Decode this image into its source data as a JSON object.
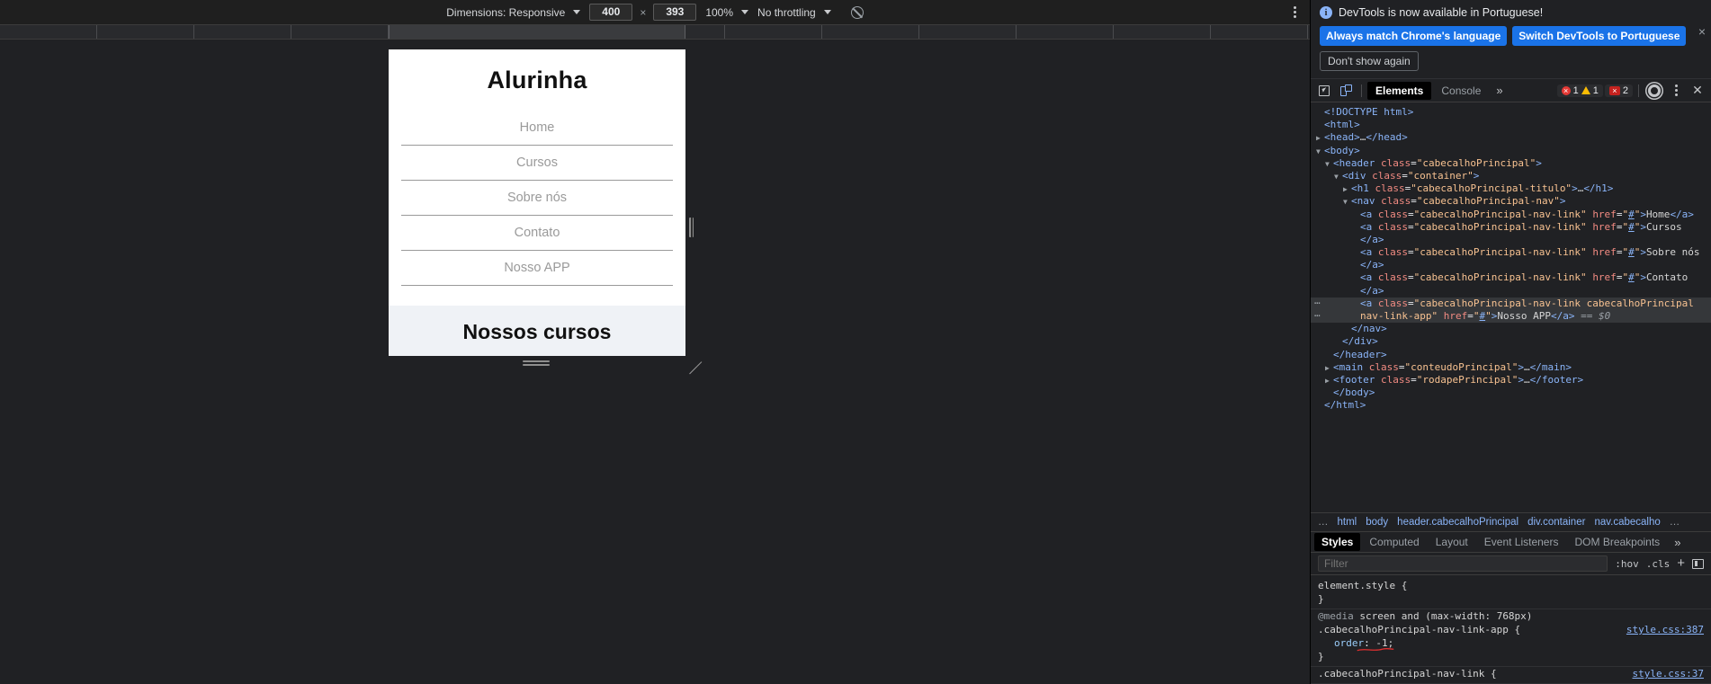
{
  "device_toolbar": {
    "dimensions_label": "Dimensions: Responsive",
    "width_value": "400",
    "times": "×",
    "height_value": "393",
    "zoom_label": "100%",
    "throttling_label": "No throttling",
    "no_throttle_icon": "no-network-throttle-icon",
    "kebab_icon": "more-options-icon"
  },
  "emulated_page": {
    "title": "Alurinha",
    "nav": [
      {
        "label": "Home"
      },
      {
        "label": "Cursos"
      },
      {
        "label": "Sobre nós"
      },
      {
        "label": "Contato"
      },
      {
        "label": "Nosso APP"
      }
    ],
    "section_title": "Nossos cursos"
  },
  "notification": {
    "info_icon": "info-icon",
    "message": "DevTools is now available in Portuguese!",
    "primary_button": "Always match Chrome's language",
    "secondary_button": "Switch DevTools to Portuguese",
    "dismiss_button": "Don't show again",
    "close_icon": "×"
  },
  "devtools_tabbar": {
    "inspect_icon": "inspect-element-icon",
    "device_icon": "toggle-device-toolbar-icon",
    "tabs": [
      {
        "label": "Elements",
        "active": true
      },
      {
        "label": "Console",
        "active": false
      }
    ],
    "more_tabs_icon": "»",
    "error_count": "1",
    "warning_count": "1",
    "issue_count": "2",
    "settings_icon": "gear-icon",
    "kebab_icon": "more-options-icon",
    "close_icon": "close-icon"
  },
  "dom_tree": {
    "lines": [
      {
        "indent": 0,
        "twisty": "",
        "html": "<span class=\"tag\">&lt;!DOCTYPE html&gt;</span>"
      },
      {
        "indent": 0,
        "twisty": "",
        "html": "<span class=\"tag\">&lt;html&gt;</span>"
      },
      {
        "indent": 0,
        "twisty": "▶",
        "html": "<span class=\"tag\">&lt;head&gt;</span><span class=\"txt\">…</span><span class=\"tag\">&lt;/head&gt;</span>"
      },
      {
        "indent": 0,
        "twisty": "▼",
        "html": "<span class=\"tag\">&lt;body&gt;</span>"
      },
      {
        "indent": 1,
        "twisty": "▼",
        "html": "<span class=\"tag\">&lt;header</span> <span class=\"attr\">class</span>=<span class=\"val\">\"cabecalhoPrincipal\"</span><span class=\"tag\">&gt;</span>"
      },
      {
        "indent": 2,
        "twisty": "▼",
        "html": "<span class=\"tag\">&lt;div</span> <span class=\"attr\">class</span>=<span class=\"val\">\"container\"</span><span class=\"tag\">&gt;</span>"
      },
      {
        "indent": 3,
        "twisty": "▶",
        "html": "<span class=\"tag\">&lt;h1</span> <span class=\"attr\">class</span>=<span class=\"val\">\"cabecalhoPrincipal-titulo\"</span><span class=\"tag\">&gt;</span><span class=\"txt\">…</span><span class=\"tag\">&lt;/h1&gt;</span>"
      },
      {
        "indent": 3,
        "twisty": "▼",
        "html": "<span class=\"tag\">&lt;nav</span> <span class=\"attr\">class</span>=<span class=\"val\">\"cabecalhoPrincipal-nav\"</span><span class=\"tag\">&gt;</span>"
      },
      {
        "indent": 4,
        "twisty": "",
        "html": "<span class=\"tag\">&lt;a</span> <span class=\"attr\">class</span>=<span class=\"val\">\"cabecalhoPrincipal-nav-link\"</span> <span class=\"attr\">href</span>=<span class=\"val\">\"<span class=\"link-u\">#</span>\"</span><span class=\"tag\">&gt;</span><span class=\"txt\">Home</span><span class=\"tag\">&lt;/a&gt;</span>"
      },
      {
        "indent": 4,
        "twisty": "",
        "html": "<span class=\"tag\">&lt;a</span> <span class=\"attr\">class</span>=<span class=\"val\">\"cabecalhoPrincipal-nav-link\"</span> <span class=\"attr\">href</span>=<span class=\"val\">\"<span class=\"link-u\">#</span>\"</span><span class=\"tag\">&gt;</span><span class=\"txt\">Cursos</span>"
      },
      {
        "indent": 4,
        "twisty": "",
        "html": "<span class=\"tag\">&lt;/a&gt;</span>"
      },
      {
        "indent": 4,
        "twisty": "",
        "html": "<span class=\"tag\">&lt;a</span> <span class=\"attr\">class</span>=<span class=\"val\">\"cabecalhoPrincipal-nav-link\"</span> <span class=\"attr\">href</span>=<span class=\"val\">\"<span class=\"link-u\">#</span>\"</span><span class=\"tag\">&gt;</span><span class=\"txt\">Sobre nós</span>"
      },
      {
        "indent": 4,
        "twisty": "",
        "html": "<span class=\"tag\">&lt;/a&gt;</span>"
      },
      {
        "indent": 4,
        "twisty": "",
        "html": "<span class=\"tag\">&lt;a</span> <span class=\"attr\">class</span>=<span class=\"val\">\"cabecalhoPrincipal-nav-link\"</span> <span class=\"attr\">href</span>=<span class=\"val\">\"<span class=\"link-u\">#</span>\"</span><span class=\"tag\">&gt;</span><span class=\"txt\">Contato</span>"
      },
      {
        "indent": 4,
        "twisty": "",
        "html": "<span class=\"tag\">&lt;/a&gt;</span>"
      },
      {
        "indent": 4,
        "twisty": "",
        "sel": true,
        "html": "<span class=\"tag\">&lt;a</span> <span class=\"attr\">class</span>=<span class=\"val\">\"cabecalhoPrincipal-nav-link cabecalhoPrincipal</span>"
      },
      {
        "indent": 4,
        "twisty": "",
        "sel": true,
        "html": "<span class=\"val\">nav-link-app\"</span> <span class=\"attr\">href</span>=<span class=\"val\">\"<span class=\"link-u\">#</span>\"</span><span class=\"tag\">&gt;</span><span class=\"txt\">Nosso APP</span><span class=\"tag\">&lt;/a&gt;</span> <span class=\"dollar\">== $0</span>"
      },
      {
        "indent": 3,
        "twisty": "",
        "html": "<span class=\"tag\">&lt;/nav&gt;</span>"
      },
      {
        "indent": 2,
        "twisty": "",
        "html": "<span class=\"tag\">&lt;/div&gt;</span>"
      },
      {
        "indent": 1,
        "twisty": "",
        "html": "<span class=\"tag\">&lt;/header&gt;</span>"
      },
      {
        "indent": 1,
        "twisty": "▶",
        "html": "<span class=\"tag\">&lt;main</span> <span class=\"attr\">class</span>=<span class=\"val\">\"conteudoPrincipal\"</span><span class=\"tag\">&gt;</span><span class=\"txt\">…</span><span class=\"tag\">&lt;/main&gt;</span>"
      },
      {
        "indent": 1,
        "twisty": "▶",
        "html": "<span class=\"tag\">&lt;footer</span> <span class=\"attr\">class</span>=<span class=\"val\">\"rodapePrincipal\"</span><span class=\"tag\">&gt;</span><span class=\"txt\">…</span><span class=\"tag\">&lt;/footer&gt;</span>"
      },
      {
        "indent": 1,
        "twisty": "",
        "html": "<span class=\"tag\">&lt;/body&gt;</span>"
      },
      {
        "indent": 0,
        "twisty": "",
        "html": "<span class=\"tag\">&lt;/html&gt;</span>"
      }
    ]
  },
  "breadcrumb": {
    "leading_dots": "…",
    "items": [
      "html",
      "body",
      "header.cabecalhoPrincipal",
      "div.container",
      "nav.cabecalho"
    ],
    "trailing_dots": "…"
  },
  "styles_pane": {
    "tabs": [
      {
        "label": "Styles",
        "active": true
      },
      {
        "label": "Computed",
        "active": false
      },
      {
        "label": "Layout",
        "active": false
      },
      {
        "label": "Event Listeners",
        "active": false
      },
      {
        "label": "DOM Breakpoints",
        "active": false
      }
    ],
    "more_tabs_icon": "»",
    "filter_placeholder": "Filter",
    "hov_label": ":hov",
    "cls_label": ".cls",
    "plus_icon": "+",
    "sidebar_icon": "toggle-sidebar-icon",
    "rules": [
      {
        "selector": "element.style {",
        "close": "}",
        "source": "",
        "declarations": []
      },
      {
        "at_rule_prefix": "@media",
        "at_rule_rest": "screen and (max-width: 768px)",
        "selector": ".cabecalhoPrincipal-nav-link-app {",
        "close": "}",
        "source": "style.css:387",
        "declarations": [
          {
            "prop": "order",
            "value": "-1;",
            "annotated": true
          }
        ]
      },
      {
        "selector": ".cabecalhoPrincipal-nav-link {",
        "close": "",
        "source": "style.css:37",
        "declarations": []
      }
    ]
  },
  "colors": {
    "accent_blue": "#1a73e8",
    "link_blue": "#8ab4f8",
    "panel_bg": "#202124",
    "annotation_red": "#e03030",
    "band_bg": "#eff2f6"
  }
}
